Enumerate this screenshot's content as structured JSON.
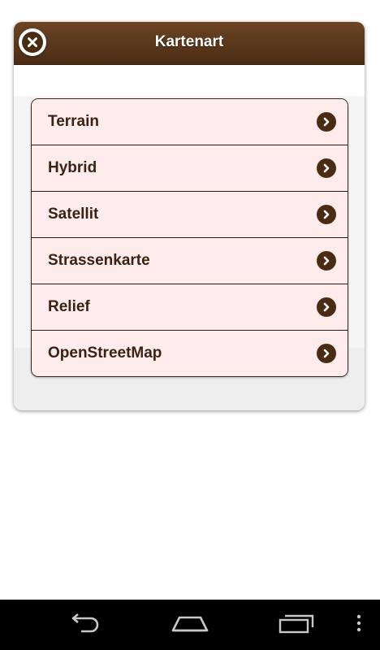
{
  "dialog": {
    "title": "Kartenart",
    "close_icon": "close-circle-icon"
  },
  "list": {
    "items": [
      {
        "label": "Terrain",
        "icon": "chevron-right-circle-icon"
      },
      {
        "label": "Hybrid",
        "icon": "chevron-right-circle-icon"
      },
      {
        "label": "Satellit",
        "icon": "chevron-right-circle-icon"
      },
      {
        "label": "Strassenkarte",
        "icon": "chevron-right-circle-icon"
      },
      {
        "label": "Relief",
        "icon": "chevron-right-circle-icon"
      },
      {
        "label": "OpenStreetMap",
        "icon": "chevron-right-circle-icon"
      }
    ]
  },
  "navbar": {
    "buttons": [
      "back-icon",
      "home-icon",
      "recent-apps-icon",
      "menu-icon"
    ]
  },
  "colors": {
    "header": "#5a3519",
    "item_background": "#fdeceb",
    "item_text": "#3a2214",
    "accent": "#4a2c15"
  }
}
